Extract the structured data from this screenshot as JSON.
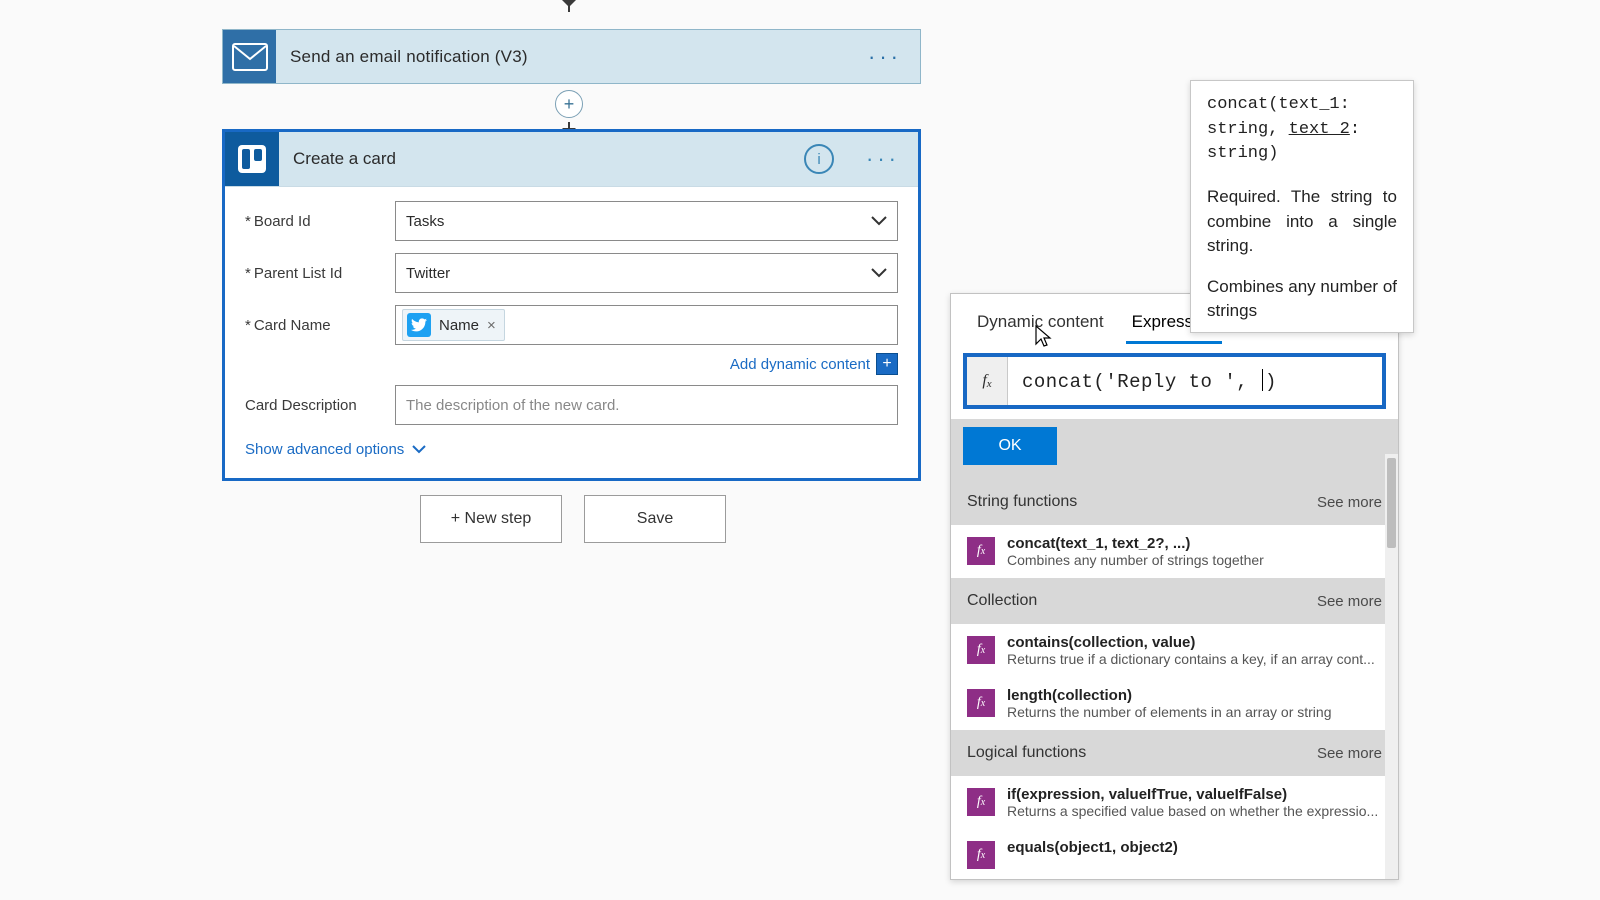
{
  "flow": {
    "email_step": {
      "title": "Send an email notification (V3)"
    },
    "trello_step": {
      "title": "Create a card",
      "fields": {
        "board_id": {
          "label": "Board Id",
          "value": "Tasks"
        },
        "parent_list": {
          "label": "Parent List Id",
          "value": "Twitter"
        },
        "card_name": {
          "label": "Card Name",
          "token": "Name"
        },
        "card_desc": {
          "label": "Card Description",
          "placeholder": "The description of the new card."
        }
      },
      "add_dynamic": "Add dynamic content",
      "advanced": "Show advanced options"
    },
    "buttons": {
      "new_step": "+ New step",
      "save": "Save"
    }
  },
  "expr": {
    "tabs": {
      "dynamic": "Dynamic content",
      "expression": "Expression"
    },
    "input": {
      "pre": "concat('Reply to ', ",
      "post": ")"
    },
    "ok": "OK",
    "sections": [
      {
        "title": "String functions",
        "see_more": "See more",
        "items": [
          {
            "sig": "concat(text_1, text_2?, ...)",
            "desc": "Combines any number of strings together"
          }
        ]
      },
      {
        "title": "Collection",
        "see_more": "See more",
        "items": [
          {
            "sig": "contains(collection, value)",
            "desc": "Returns true if a dictionary contains a key, if an array cont..."
          },
          {
            "sig": "length(collection)",
            "desc": "Returns the number of elements in an array or string"
          }
        ]
      },
      {
        "title": "Logical functions",
        "see_more": "See more",
        "items": [
          {
            "sig": "if(expression, valueIfTrue, valueIfFalse)",
            "desc": "Returns a specified value based on whether the expressio..."
          },
          {
            "sig": "equals(object1, object2)",
            "desc": ""
          }
        ]
      }
    ]
  },
  "tooltip": {
    "sig_pre": "concat(text_1: string, ",
    "sig_cur": "text_2",
    "sig_post": ": string)",
    "desc": "Required. The string to combine into a single string.",
    "foot": "Combines any number of strings"
  }
}
